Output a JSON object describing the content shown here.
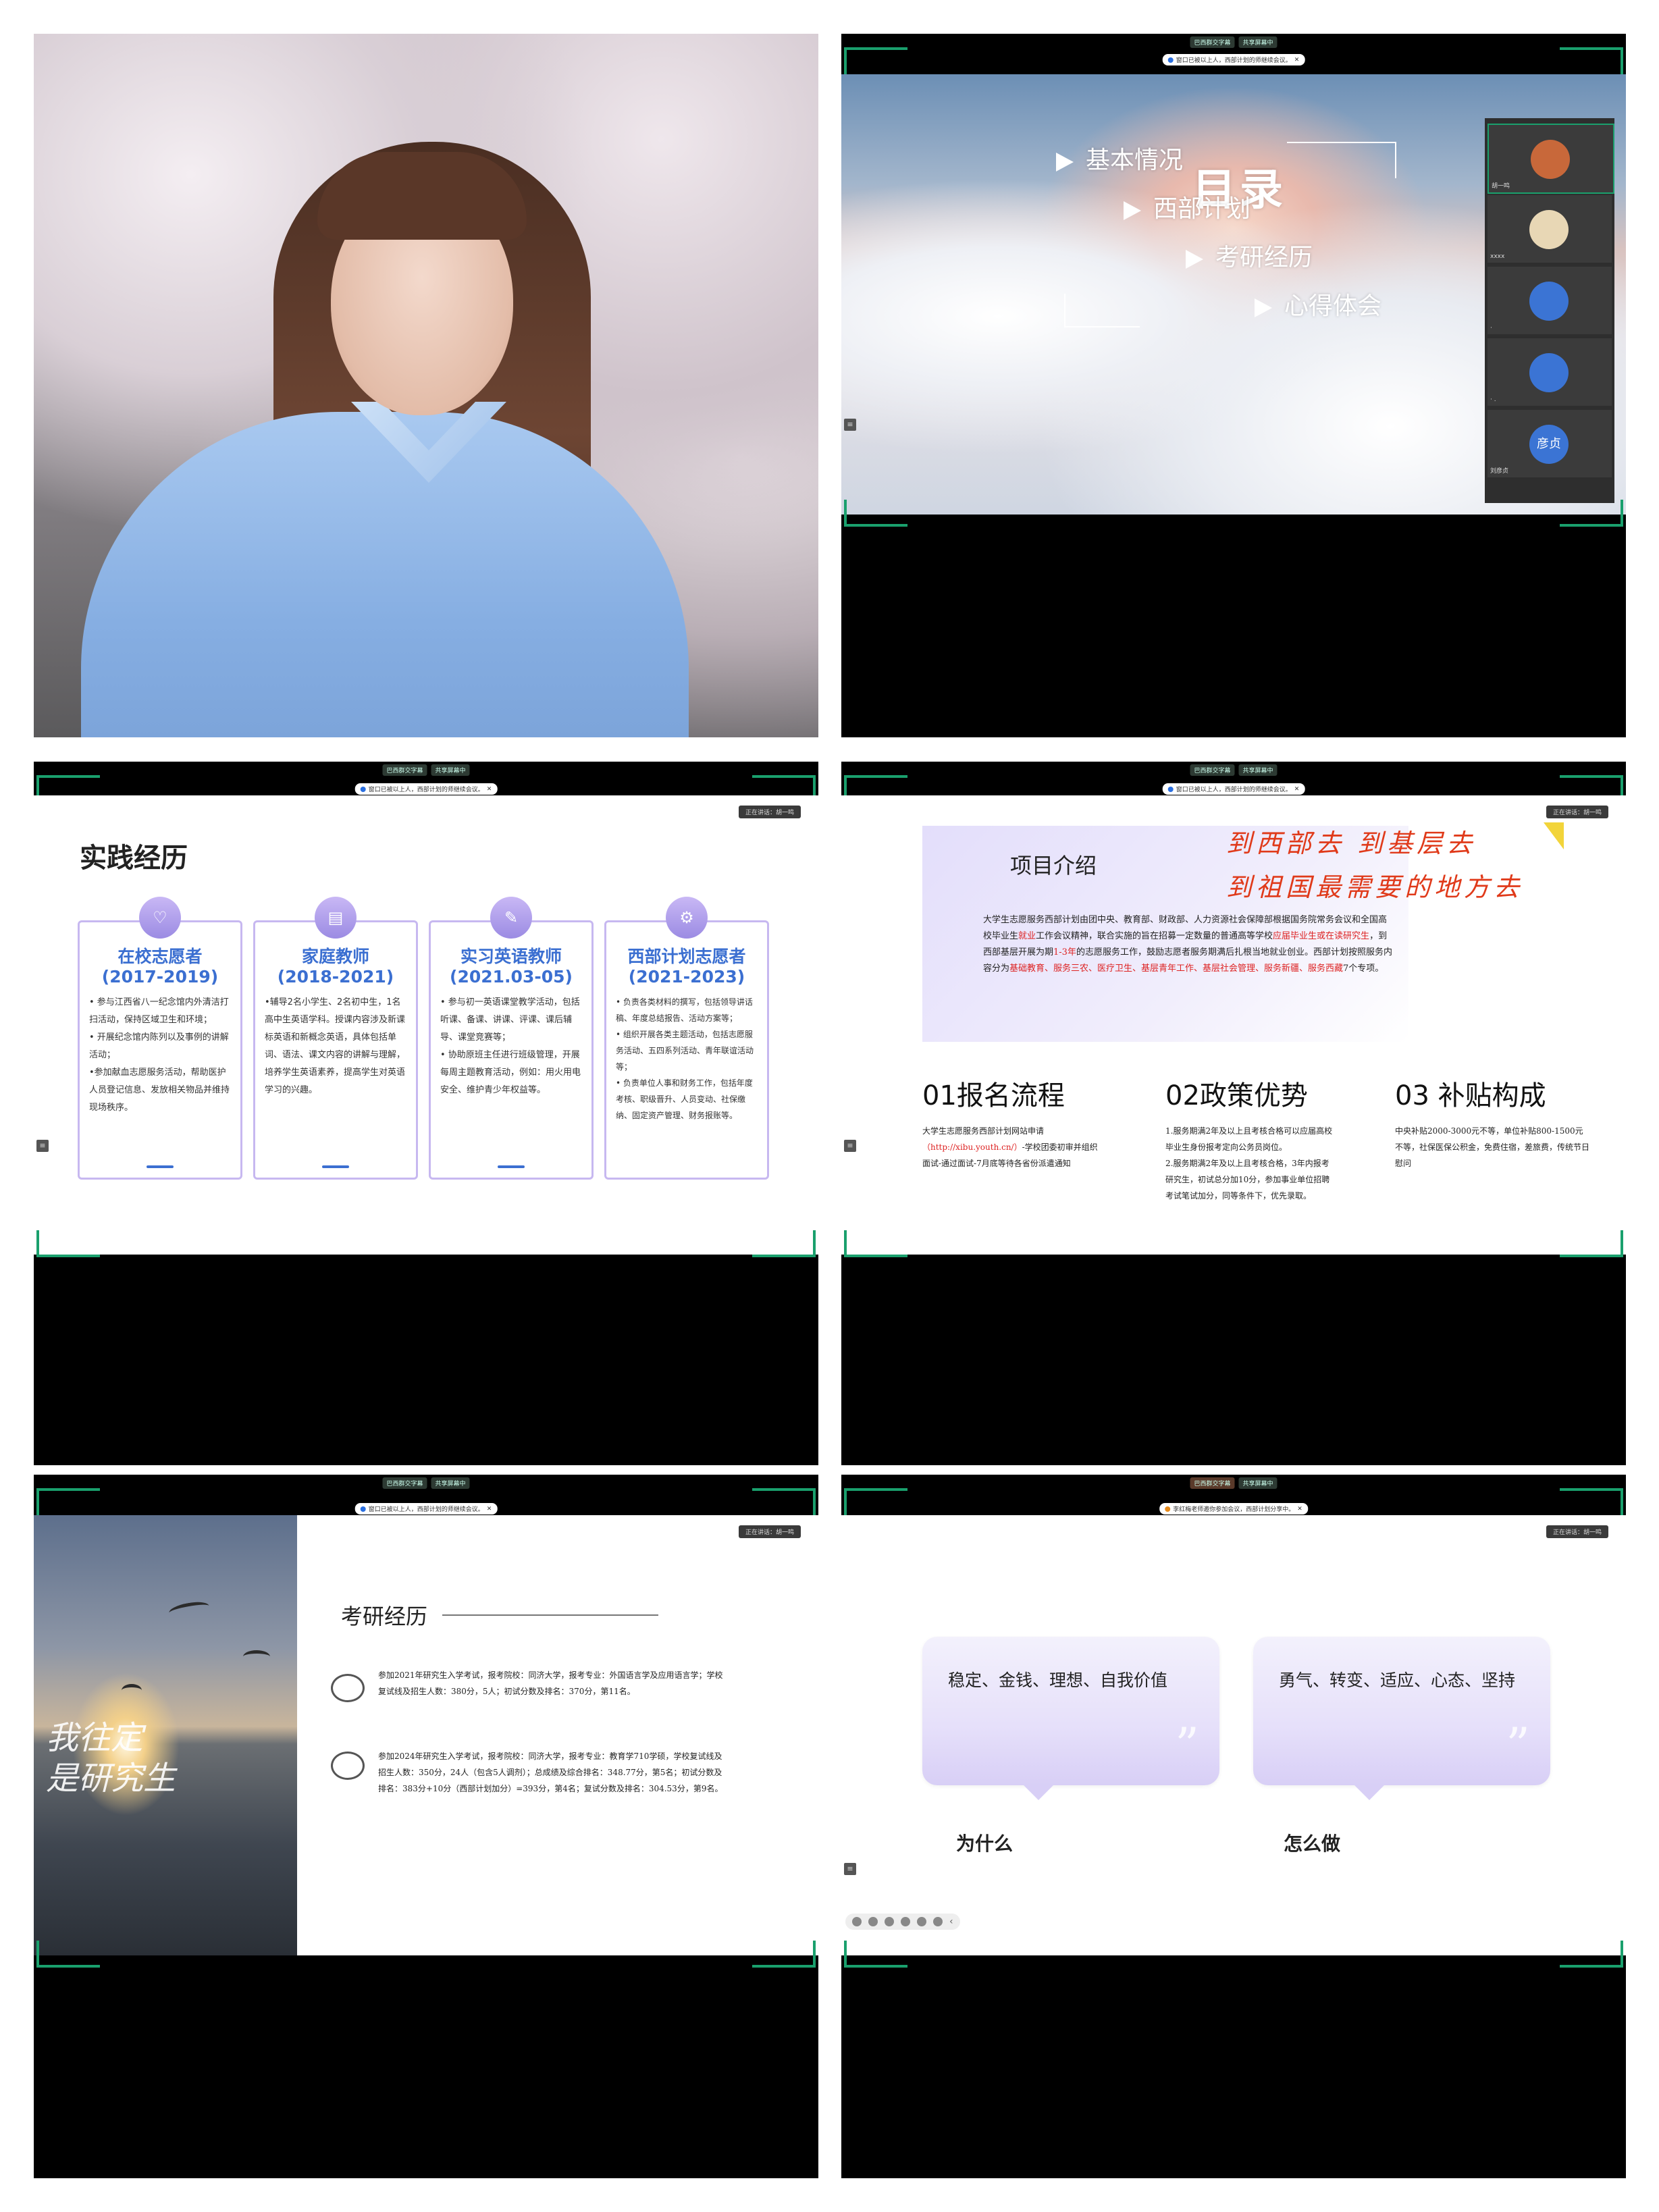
{
  "meeting": {
    "pill_left": "巴西群交字幕",
    "pill_right": "共享屏幕中",
    "notice": "窗口已被以上人，西部计划的师继续会议。",
    "notice_p6": "李红梅老师邀你参加会议，西部计划分享中。",
    "speaker": "正在讲话：胡一鸣",
    "side_button": "≡"
  },
  "photo": {
    "scene": "cherry-blossom portrait"
  },
  "toc": {
    "title": "目录",
    "items": [
      "基本情况",
      "西部计划",
      "考研经历",
      "心得体会"
    ],
    "participants": [
      {
        "label": "胡一鸣",
        "color": "#c8683a"
      },
      {
        "label": "xxxx",
        "color": "#e8d7b5"
      },
      {
        "label": "·",
        "color": "#3b74d4"
      },
      {
        "label": "· .",
        "color": "#3b74d4"
      },
      {
        "label": "刘彦贞",
        "color": "#3b74d4",
        "initials": "彦贞"
      }
    ]
  },
  "practice": {
    "title": "实践经历",
    "cards": [
      {
        "icon": "♡",
        "title": "在校志愿者",
        "years": "(2017-2019)",
        "body": "• 参与江西省八一纪念馆内外清洁打扫活动，保持区域卫生和环境；\n• 开展纪念馆内陈列以及事例的讲解活动；\n•参加献血志愿服务活动，帮助医护人员登记信息、发放相关物品并维持现场秩序。"
      },
      {
        "icon": "▤",
        "title": "家庭教师",
        "years": "(2018-2021)",
        "body": "•辅导2名小学生、2名初中生，1名高中生英语学科。授课内容涉及新课标英语和新概念英语，具体包括单词、语法、课文内容的讲解与理解，培养学生英语素养，提高学生对英语学习的兴趣。"
      },
      {
        "icon": "✎",
        "title": "实习英语教师",
        "years": "(2021.03-05)",
        "body": "• 参与初一英语课堂教学活动，包括听课、备课、讲课、评课、课后辅导、课堂竞赛等；\n• 协助原班主任进行班级管理，开展每周主题教育活动，例如：用火用电安全、维护青少年权益等。"
      },
      {
        "icon": "⚙",
        "title": "西部计划志愿者",
        "years": "(2021-2023)",
        "body": "• 负责各类材料的撰写，包括领导讲话稿、年度总结报告、活动方案等；\n• 组织开展各类主题活动，包括志愿服务活动、五四系列活动、青年联谊活动等；\n• 负责单位人事和财务工作，包括年度考核、职级晋升、人员变动、社保缴纳、固定资产管理、财务报账等。"
      }
    ]
  },
  "project": {
    "intro_title": "项目介绍",
    "intro_body_1": "大学生志愿服务西部计划由团中央、教育部、财政部、人力资源社会保障部根据国务院常务会议和全国高校毕业生",
    "intro_body_red1": "就业",
    "intro_body_2": "工作会议精神，联合实施的旨在招募一定数量的普通高等学校",
    "intro_body_red2": "应届毕业生或在读研究生",
    "intro_body_3": "，到西部基层开展为期",
    "intro_body_red3": "1-3年",
    "intro_body_4": "的志愿服务工作，鼓励志愿者服务期满后扎根当地就业创业。西部计划按照服务内容分为",
    "intro_body_red4": "基础教育、服务三农、医疗卫生、基层青年工作、基层社会管理、服务新疆、服务西藏",
    "intro_body_5": "7个专项。",
    "slogan_1": "到西部去  到基层去",
    "slogan_2": "到祖国最需要的地方去",
    "cols": [
      {
        "head": "01报名流程",
        "body": "大学生志愿服务西部计划网站申请",
        "link": "（http://xibu.youth.cn/）",
        "body2": "-学校团委初审并组织面试-通过面试-7月底等待各省份派遣通知"
      },
      {
        "head": "02政策优势",
        "body": "1.服务期满2年及以上且考核合格可以应届高校毕业生身份报考定向公务员岗位。\n2.服务期满2年及以上且考核合格，3年内报考研究生，初试总分加10分，参加事业单位招聘考试笔试加分，同等条件下，优先录取。",
        "link": "",
        "body2": ""
      },
      {
        "head": "03 补贴构成",
        "body": "中央补贴2000-3000元不等，单位补贴800-1500元不等，社保医保公积金，免费住宿，差旅费，传统节日慰问",
        "link": "",
        "body2": ""
      }
    ]
  },
  "kaoyan": {
    "side_text_1": "我往定",
    "side_text_2": "是研究生",
    "title": "考研经历",
    "para_1": "参加2021年研究生入学考试，报考院校：同济大学，报考专业：外国语言学及应用语言学；学校复试线及招生人数：380分，5人；初试分数及排名：370分，第11名。",
    "para_2": "参加2024年研究生入学考试，报考院校：同济大学，报考专业：教育学710学硕，学校复试线及招生人数：350分，24人（包含5人调剂）；总成绩及综合排名：348.77分，第5名；初试分数及排名：383分+10分（西部计划加分）=393分，第4名；复试分数及排名：304.53分，第9名。"
  },
  "why_how": {
    "card_1": "稳定、金钱、理想、自我价值",
    "card_2": "勇气、转变、适应、心态、坚持",
    "label_1": "为什么",
    "label_2": "怎么做",
    "quote_mark": "”"
  },
  "colors": {
    "accent_green": "#1aa06d",
    "card_border": "#c7b8f0",
    "title_blue": "#3b6fd1",
    "slogan_red": "#e03a1a"
  }
}
